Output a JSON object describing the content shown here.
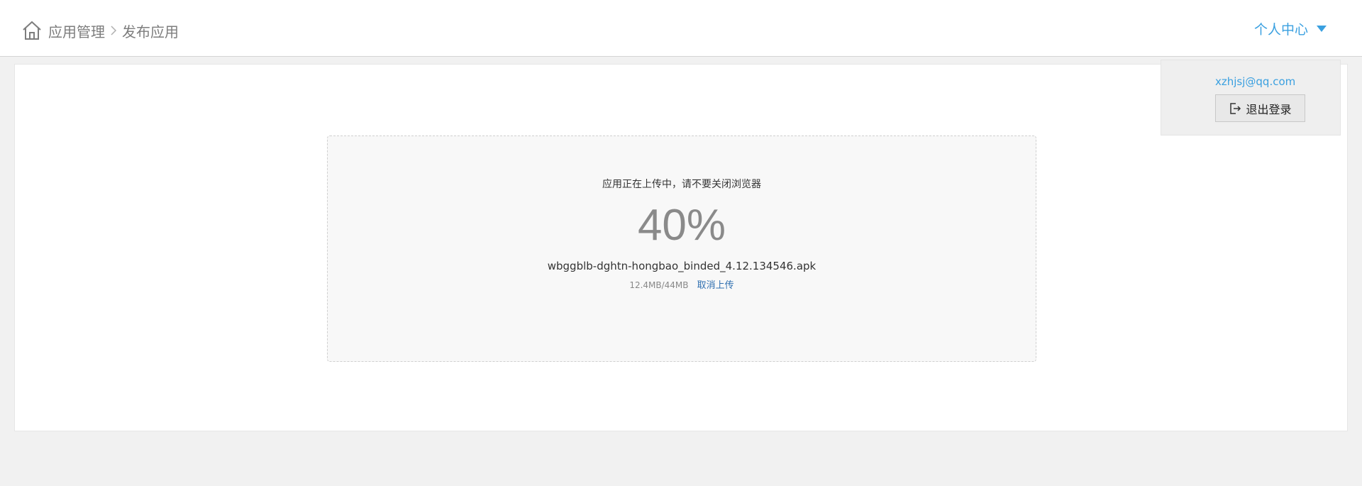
{
  "header": {
    "breadcrumb": {
      "home_icon": "home-icon",
      "items": [
        "应用管理",
        "发布应用"
      ],
      "separator_icon": "chevron-right-icon"
    },
    "user_menu": {
      "label": "个人中心",
      "icon": "caret-down-icon"
    }
  },
  "dropdown": {
    "email": "xzhjsj@qq.com",
    "logout_label": "退出登录",
    "logout_icon": "logout-icon"
  },
  "upload": {
    "hint": "应用正在上传中，请不要关闭浏览器",
    "percent_text": "40%",
    "progress": 0.4,
    "filename": "wbggblb-dghtn-hongbao_binded_4.12.134546.apk",
    "size_text": "12.4MB/44MB",
    "cancel_label": "取消上传"
  },
  "colors": {
    "accent": "#3aa0e0",
    "link": "#2f6fb0",
    "background": "#f1f1f1"
  }
}
